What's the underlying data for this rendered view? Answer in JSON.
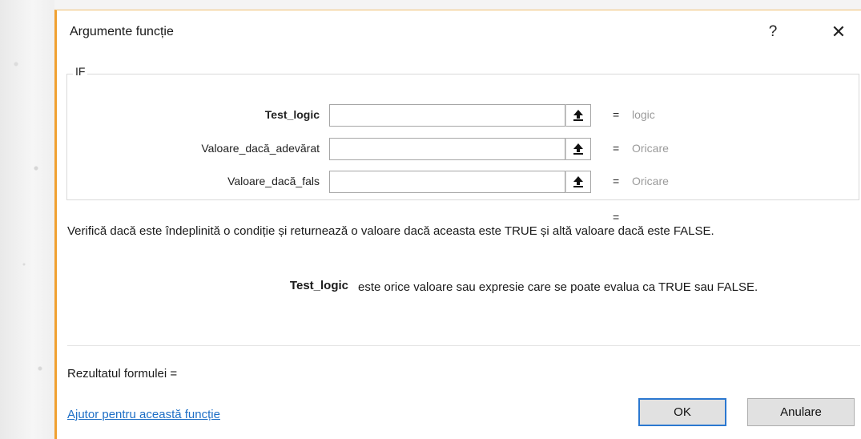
{
  "dialog": {
    "title": "Argumente funcție",
    "help_symbol": "?",
    "close_symbol": "✕"
  },
  "function_group": {
    "label": "IF",
    "arguments": [
      {
        "label": "Test_logic",
        "value": "",
        "equals": "=",
        "result_hint": "logic"
      },
      {
        "label": "Valoare_dacă_adevărat",
        "value": "",
        "equals": "=",
        "result_hint": "Oricare"
      },
      {
        "label": "Valoare_dacă_fals",
        "value": "",
        "equals": "=",
        "result_hint": "Oricare"
      }
    ]
  },
  "function_result_equals": "=",
  "description": "Verifică dacă este îndeplinită o condiție și returnează o valoare dacă aceasta este TRUE și altă valoare dacă este FALSE.",
  "argument_help": {
    "name": "Test_logic",
    "text": "este orice valoare sau expresie care se poate evalua ca TRUE sau FALSE."
  },
  "formula_result_label": "Rezultatul formulei =",
  "help_link": "Ajutor pentru această funcție",
  "buttons": {
    "ok": "OK",
    "cancel": "Anulare"
  },
  "colors": {
    "accent": "#2b78d0",
    "link": "#1e6fc6",
    "window_border": "#f0a030",
    "hint_text": "#9a9a9a"
  },
  "icons": {
    "reference": "collapse-dialog-icon"
  }
}
